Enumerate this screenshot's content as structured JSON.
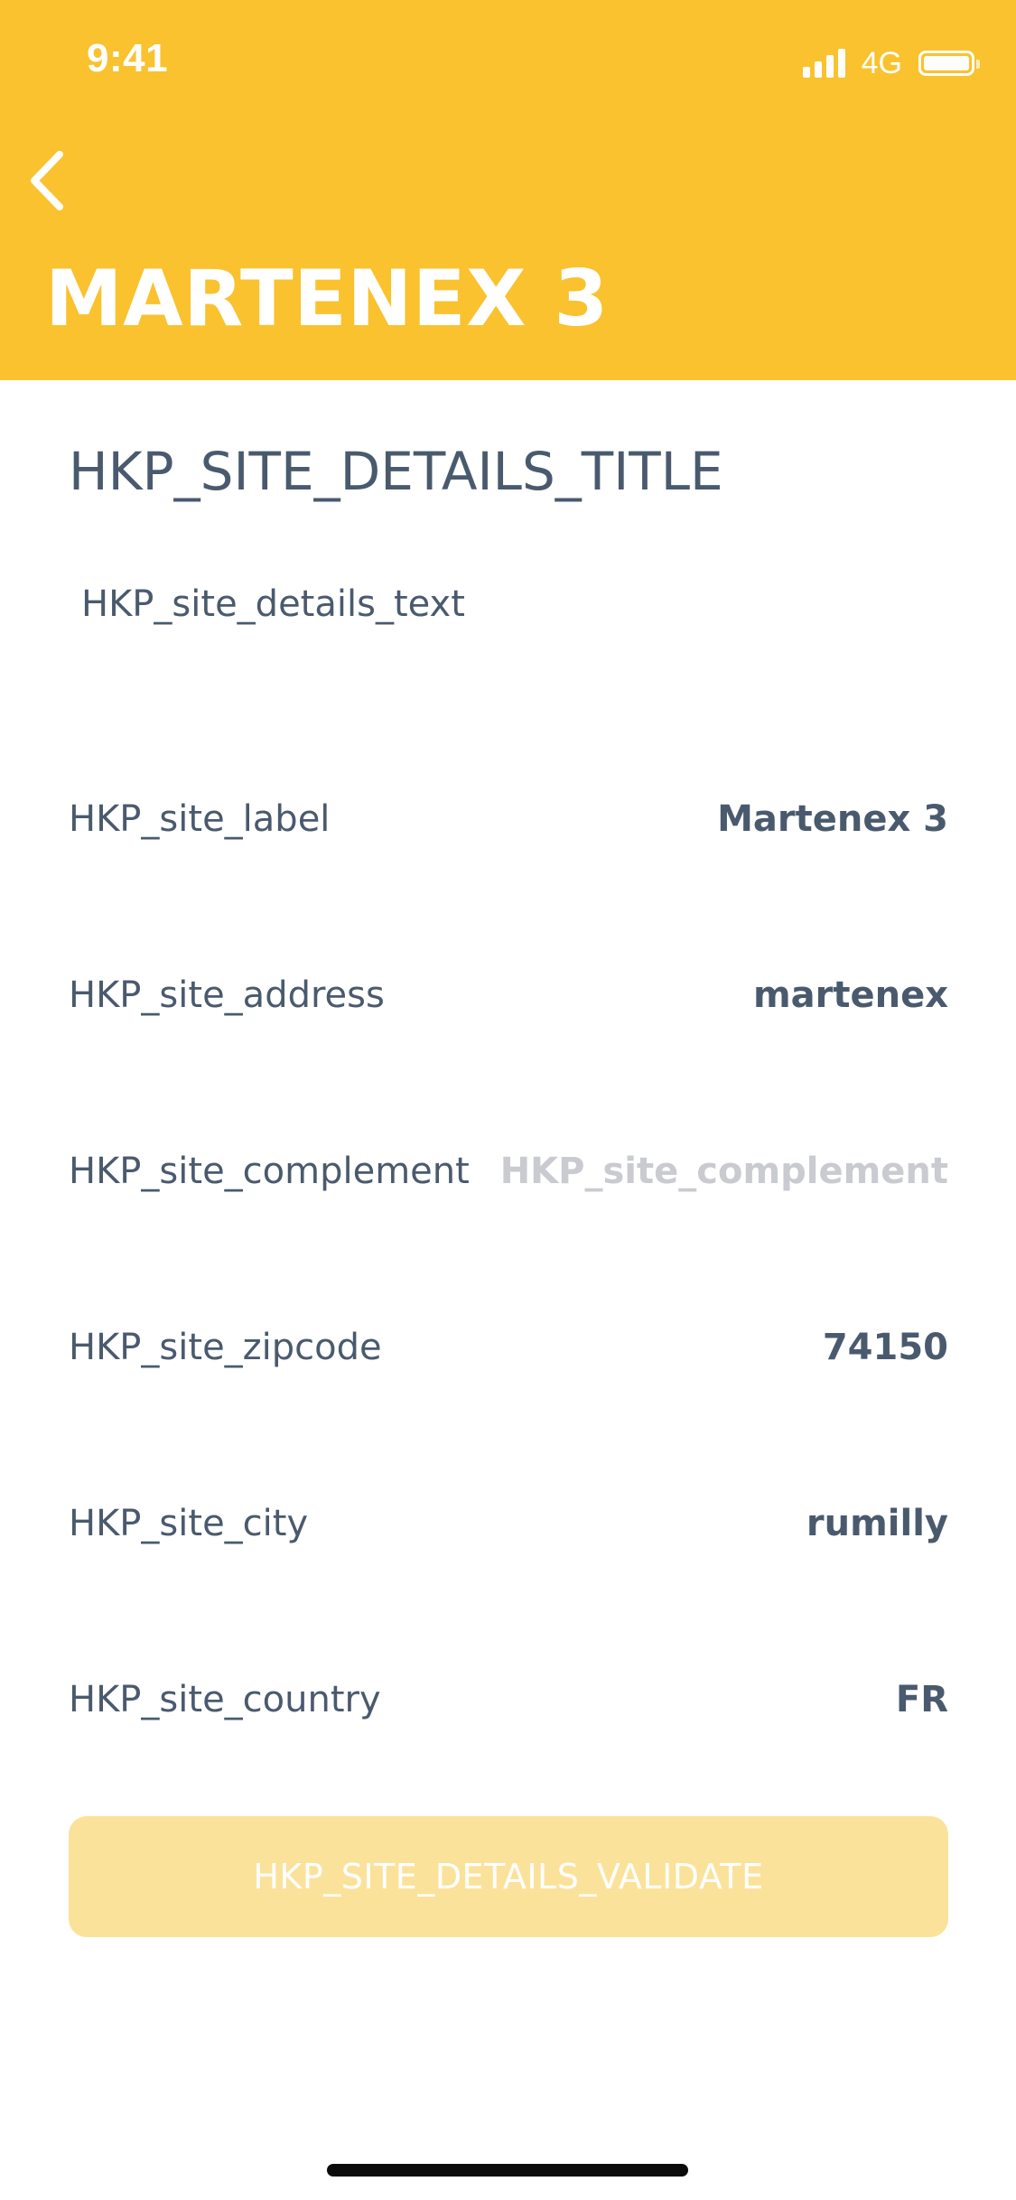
{
  "status_bar": {
    "time": "9:41",
    "network": "4G"
  },
  "header": {
    "title": "MARTENEX 3",
    "background_color": "#f9c22e",
    "back_icon": "chevron-left-icon"
  },
  "content": {
    "title": "HKP_SITE_DETAILS_TITLE",
    "text": "HKP_site_details_text"
  },
  "fields": [
    {
      "label": "HKP_site_label",
      "value": "Martenex 3",
      "placeholder": ""
    },
    {
      "label": "HKP_site_address",
      "value": "martenex",
      "placeholder": ""
    },
    {
      "label": "HKP_site_complement",
      "value": "",
      "placeholder": "HKP_site_complement"
    },
    {
      "label": "HKP_site_zipcode",
      "value": "74150",
      "placeholder": ""
    },
    {
      "label": "HKP_site_city",
      "value": "rumilly",
      "placeholder": ""
    },
    {
      "label": "HKP_site_country",
      "value": "FR",
      "placeholder": ""
    }
  ],
  "validate_button": {
    "label": "HKP_SITE_DETAILS_VALIDATE",
    "color": "#fbe29b"
  }
}
